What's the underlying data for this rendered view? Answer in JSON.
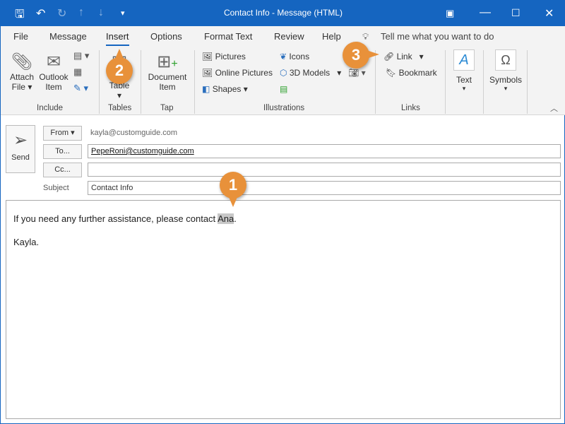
{
  "window": {
    "title": "Contact Info  -  Message (HTML)"
  },
  "tabs": [
    {
      "label": "File"
    },
    {
      "label": "Message"
    },
    {
      "label": "Insert"
    },
    {
      "label": "Options"
    },
    {
      "label": "Format Text"
    },
    {
      "label": "Review"
    },
    {
      "label": "Help"
    }
  ],
  "tell_me": "Tell me what you want to do",
  "ribbon": {
    "include": {
      "label": "Include",
      "attach_file": [
        "Attach",
        "File"
      ],
      "outlook_item": [
        "Outlook",
        "Item"
      ]
    },
    "tables": {
      "label": "Tables",
      "table": "Table"
    },
    "tap": {
      "label": "Tap",
      "document_item": [
        "Document",
        "Item"
      ]
    },
    "illustrations": {
      "label": "Illustrations",
      "pictures": "Pictures",
      "online_pictures": "Online Pictures",
      "shapes": "Shapes",
      "icons": "Icons",
      "models_3d": "3D Models"
    },
    "links": {
      "label": "Links",
      "link": "Link",
      "bookmark": "Bookmark"
    },
    "text": {
      "label": "Text"
    },
    "symbols": {
      "label": "Symbols"
    }
  },
  "callouts": [
    "1",
    "2",
    "3"
  ],
  "message": {
    "send": "Send",
    "from_label": "From",
    "from_value": "kayla@customguide.com",
    "to_label": "To...",
    "to_value": "PepeRoni@customguide.com",
    "cc_label": "Cc...",
    "cc_value": "",
    "subject_label": "Subject",
    "subject_value": "Contact Info",
    "body_line1_pre": "If you need any further assistance, please contact ",
    "body_selected": "Ana",
    "body_line1_post": ".",
    "body_line2": "Kayla."
  },
  "colors": {
    "accent": "#1565c0",
    "callout": "#e8913a",
    "selection": "#c8c8c8"
  }
}
